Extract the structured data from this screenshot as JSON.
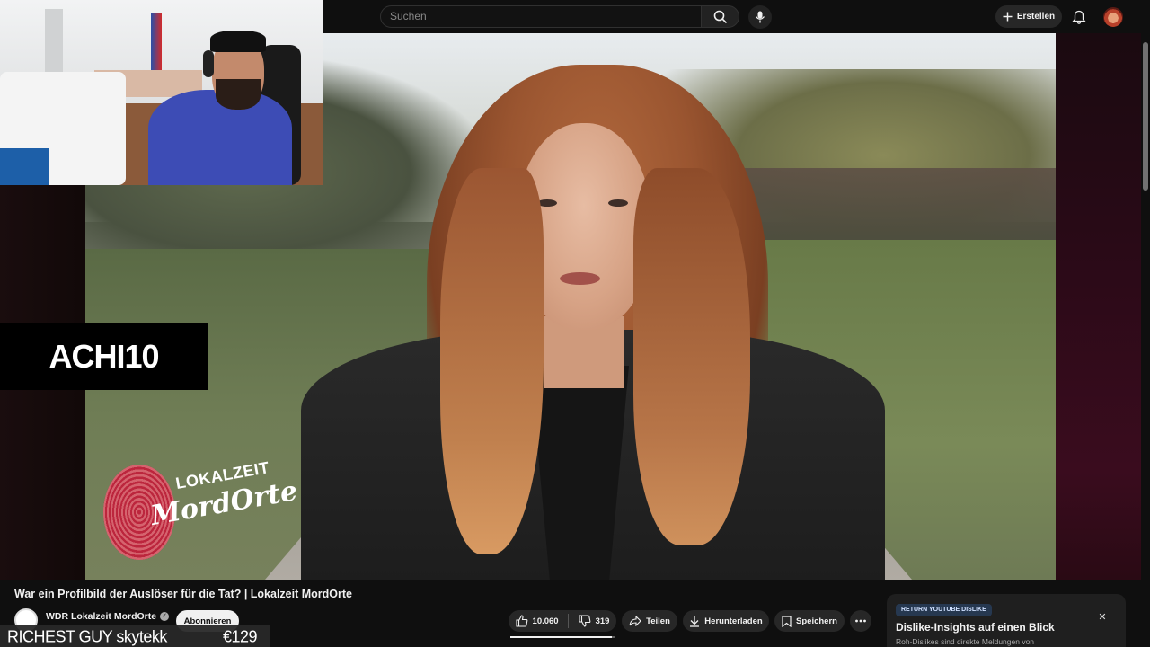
{
  "topbar": {
    "search_placeholder": "Suchen",
    "create_label": "Erstellen"
  },
  "overlay": {
    "badge_text": "ACHI10",
    "logo_line1": "LOKALZEIT",
    "logo_line2": "MordOrte",
    "ticker_left": "RICHEST GUY skytekk",
    "ticker_right": "€129"
  },
  "video": {
    "title": "War ein Profilbild der Auslöser für die Tat? | Lokalzeit MordOrte",
    "channel_name": "WDR Lokalzeit MordOrte",
    "subscribe_label": "Abonnieren",
    "like_count": "10.060",
    "dislike_count": "319",
    "like_ratio": 0.969,
    "share_label": "Teilen",
    "download_label": "Herunterladen",
    "save_label": "Speichern"
  },
  "ryd": {
    "badge": "RETURN YOUTUBE DISLIKE",
    "title": "Dislike-Insights auf einen Blick",
    "subtitle": "Roh-Dislikes sind direkte Meldungen von"
  },
  "colors": {
    "accent_badge": "#263850",
    "logo_red": "#c41c3a"
  }
}
